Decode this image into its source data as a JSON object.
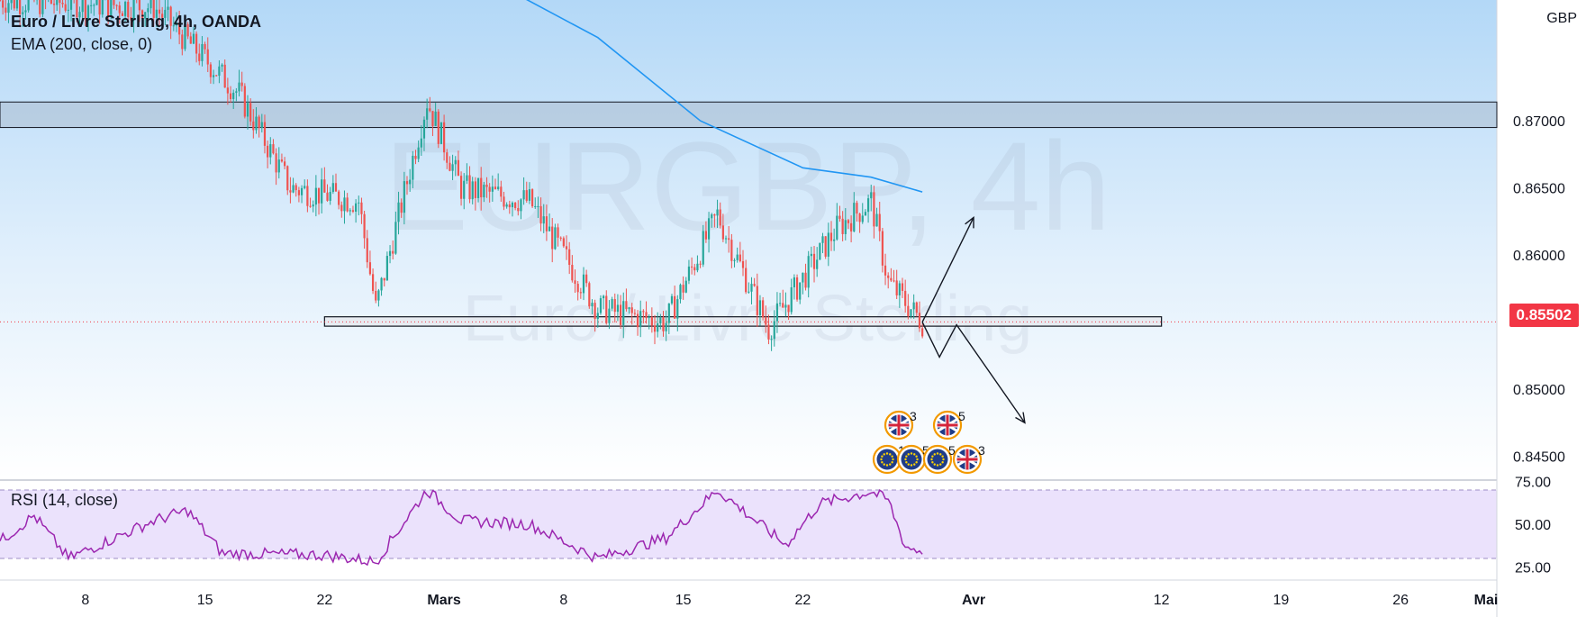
{
  "header": {
    "symbol_line": "Euro / Livre Sterling, 4h, OANDA",
    "indicator_line": "EMA (200, close, 0)",
    "currency": "GBP"
  },
  "watermark": {
    "ticker": "EURGBP, 4h",
    "name": "Euro / Livre Sterling"
  },
  "price_axis": {
    "ticks": [
      "0.87000",
      "0.86500",
      "0.86000",
      "0.85000",
      "0.84500"
    ],
    "current_price": "0.85502"
  },
  "rsi_pane": {
    "label": "RSI (14, close)",
    "ticks": [
      "75.00",
      "50.00",
      "25.00"
    ]
  },
  "time_axis": {
    "ticks": [
      "8",
      "15",
      "22",
      "Mars",
      "8",
      "15",
      "22",
      "Avr",
      "12",
      "19",
      "26",
      "Mai"
    ]
  },
  "events": [
    {
      "flag": "gb",
      "count": "3"
    },
    {
      "flag": "gb",
      "count": "5"
    },
    {
      "flag": "eu",
      "count": "10"
    },
    {
      "flag": "eu",
      "count": "5"
    },
    {
      "flag": "eu",
      "count": "5"
    },
    {
      "flag": "gb",
      "count": "3"
    }
  ],
  "colors": {
    "up": "#26a69a",
    "down": "#ef5350",
    "ema": "#2196f3",
    "rsi": "#9c27b0",
    "current_price": "#f23645"
  },
  "chart_data": {
    "type": "candlestick",
    "symbol": "EURGBP",
    "timeframe": "4h",
    "x_range": [
      "2021-02-03",
      "2021-05-01"
    ],
    "y_range": [
      0.8433,
      0.879
    ],
    "price_path": [
      {
        "date": "2021-02-03",
        "price": 0.879
      },
      {
        "date": "2021-02-12",
        "price": 0.8785
      },
      {
        "date": "2021-02-17",
        "price": 0.872
      },
      {
        "date": "2021-02-20",
        "price": 0.865
      },
      {
        "date": "2021-02-24",
        "price": 0.864
      },
      {
        "date": "2021-02-25",
        "price": 0.856
      },
      {
        "date": "2021-02-28",
        "price": 0.8715
      },
      {
        "date": "2021-03-02",
        "price": 0.865
      },
      {
        "date": "2021-03-06",
        "price": 0.864
      },
      {
        "date": "2021-03-10",
        "price": 0.856
      },
      {
        "date": "2021-03-14",
        "price": 0.855
      },
      {
        "date": "2021-03-17",
        "price": 0.863
      },
      {
        "date": "2021-03-20",
        "price": 0.8545
      },
      {
        "date": "2021-03-24",
        "price": 0.862
      },
      {
        "date": "2021-03-26",
        "price": 0.864
      },
      {
        "date": "2021-03-27",
        "price": 0.858
      },
      {
        "date": "2021-03-29",
        "price": 0.855
      }
    ],
    "ema_200": [
      {
        "date": "2021-02-28",
        "price": 0.883
      },
      {
        "date": "2021-03-10",
        "price": 0.8762
      },
      {
        "date": "2021-03-16",
        "price": 0.87
      },
      {
        "date": "2021-03-22",
        "price": 0.8665
      },
      {
        "date": "2021-03-26",
        "price": 0.8658
      },
      {
        "date": "2021-03-29",
        "price": 0.8647
      }
    ],
    "resistance_zone": [
      0.8695,
      0.8714
    ],
    "support_zone": {
      "from": "2021-02-22",
      "to": "2021-04-12",
      "low": 0.8547,
      "high": 0.8554
    },
    "projection_up": [
      {
        "date": "2021-03-29",
        "price": 0.855
      },
      {
        "date": "2021-04-01",
        "price": 0.8628
      }
    ],
    "projection_down": [
      {
        "date": "2021-03-29",
        "price": 0.855
      },
      {
        "date": "2021-03-30",
        "price": 0.8524
      },
      {
        "date": "2021-03-31",
        "price": 0.8548
      },
      {
        "date": "2021-04-04",
        "price": 0.8475
      }
    ],
    "current_price": 0.85502,
    "rsi": {
      "period": 14,
      "levels": [
        30,
        70
      ],
      "y_range": [
        18,
        80
      ],
      "path": [
        {
          "date": "2021-02-03",
          "value": 40
        },
        {
          "date": "2021-02-05",
          "value": 55
        },
        {
          "date": "2021-02-07",
          "value": 30
        },
        {
          "date": "2021-02-12",
          "value": 52
        },
        {
          "date": "2021-02-14",
          "value": 58
        },
        {
          "date": "2021-02-16",
          "value": 33
        },
        {
          "date": "2021-02-22",
          "value": 32
        },
        {
          "date": "2021-02-25",
          "value": 28
        },
        {
          "date": "2021-02-28",
          "value": 70
        },
        {
          "date": "2021-03-02",
          "value": 52
        },
        {
          "date": "2021-03-06",
          "value": 50
        },
        {
          "date": "2021-03-10",
          "value": 30
        },
        {
          "date": "2021-03-14",
          "value": 42
        },
        {
          "date": "2021-03-17",
          "value": 70
        },
        {
          "date": "2021-03-21",
          "value": 38
        },
        {
          "date": "2021-03-23",
          "value": 62
        },
        {
          "date": "2021-03-26",
          "value": 69
        },
        {
          "date": "2021-03-27",
          "value": 64
        },
        {
          "date": "2021-03-28",
          "value": 37
        },
        {
          "date": "2021-03-29",
          "value": 34
        }
      ]
    }
  }
}
